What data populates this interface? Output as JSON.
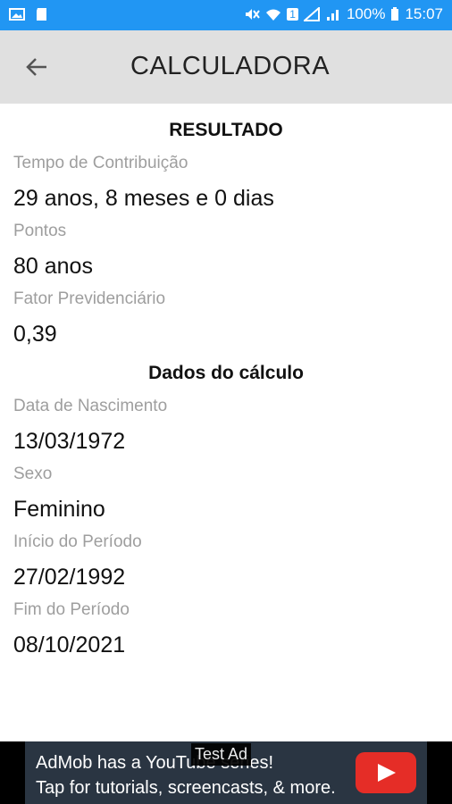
{
  "status_bar": {
    "battery": "100%",
    "time": "15:07",
    "sim_badge": "1"
  },
  "app_bar": {
    "title": "CALCULADORA"
  },
  "result": {
    "heading": "RESULTADO",
    "fields": [
      {
        "label": "Tempo de Contribuição",
        "value": "29 anos, 8 meses e 0 dias"
      },
      {
        "label": "Pontos",
        "value": "80 anos"
      },
      {
        "label": "Fator Previdenciário",
        "value": "0,39"
      }
    ]
  },
  "calc_data": {
    "heading": "Dados do cálculo",
    "fields": [
      {
        "label": "Data de Nascimento",
        "value": "13/03/1972"
      },
      {
        "label": "Sexo",
        "value": "Feminino"
      },
      {
        "label": "Início do Período",
        "value": "27/02/1992"
      },
      {
        "label": "Fim do Período",
        "value": "08/10/2021"
      }
    ]
  },
  "ad": {
    "badge": "Test Ad",
    "line1": "AdMob has a YouTube series!",
    "line2": "Tap for tutorials, screencasts, & more."
  },
  "colors": {
    "status_bar": "#2196f3",
    "app_bar": "#e0e0e0",
    "label": "#9e9e9e",
    "ad_bg": "#2a3542",
    "youtube_red": "#e52d27"
  }
}
